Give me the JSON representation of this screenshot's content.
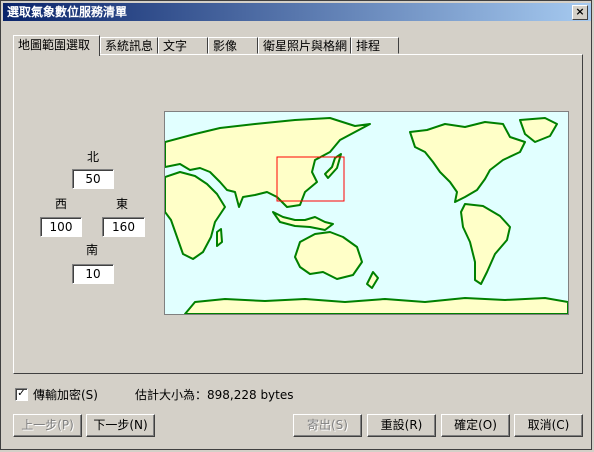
{
  "window": {
    "title": "選取氣象數位服務清單",
    "close": "×"
  },
  "tabs": [
    {
      "label": "地圖範圍選取",
      "active": true
    },
    {
      "label": "系統訊息"
    },
    {
      "label": "文字"
    },
    {
      "label": "影像"
    },
    {
      "label": "衛星照片與格網"
    },
    {
      "label": "排程"
    }
  ],
  "bounds": {
    "north_label": "北",
    "north_value": "50",
    "west_label": "西",
    "west_value": "100",
    "east_label": "東",
    "east_value": "160",
    "south_label": "南",
    "south_value": "10"
  },
  "options": {
    "encrypt_label": "傳輸加密(S)",
    "encrypt_checked": true,
    "size_label": "估計大小為：898,228 bytes"
  },
  "buttons": {
    "prev": "上一步(P)",
    "next": "下一步(N)",
    "export": "寄出(S)",
    "reset": "重設(R)",
    "ok": "確定(O)",
    "cancel": "取消(C)"
  },
  "colors": {
    "sea": "#e1ffff",
    "land": "#ffffc8",
    "coast": "#008000",
    "selection": "#ff0000"
  }
}
